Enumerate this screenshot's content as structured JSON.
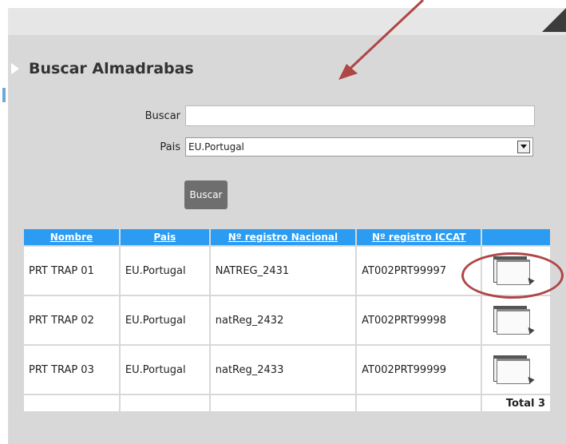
{
  "section": {
    "title": "Buscar Almadrabas"
  },
  "form": {
    "buscar_label": "Buscar",
    "buscar_value": "",
    "pais_label": "Pais",
    "pais_selected": "EU.Portugal",
    "submit_label": "Buscar"
  },
  "table": {
    "headers": [
      "Nombre",
      "Pais",
      "Nº registro Nacional",
      "Nº registro ICCAT",
      ""
    ],
    "rows": [
      [
        "PRT TRAP 01",
        "EU.Portugal",
        "NATREG_2431",
        "AT002PRT99997"
      ],
      [
        "PRT TRAP 02",
        "EU.Portugal",
        "natReg_2432",
        "AT002PRT99998"
      ],
      [
        "PRT TRAP 03",
        "EU.Portugal",
        "natReg_2433",
        "AT002PRT99999"
      ]
    ],
    "total": "Total 3"
  },
  "icons": {
    "row_action": "window-cursor-icon",
    "collapse": "triangle-right-icon"
  },
  "colors": {
    "header_blue": "#2b9cf2",
    "annotation_red": "#b04545",
    "panel_grey": "#d8d8d8"
  }
}
